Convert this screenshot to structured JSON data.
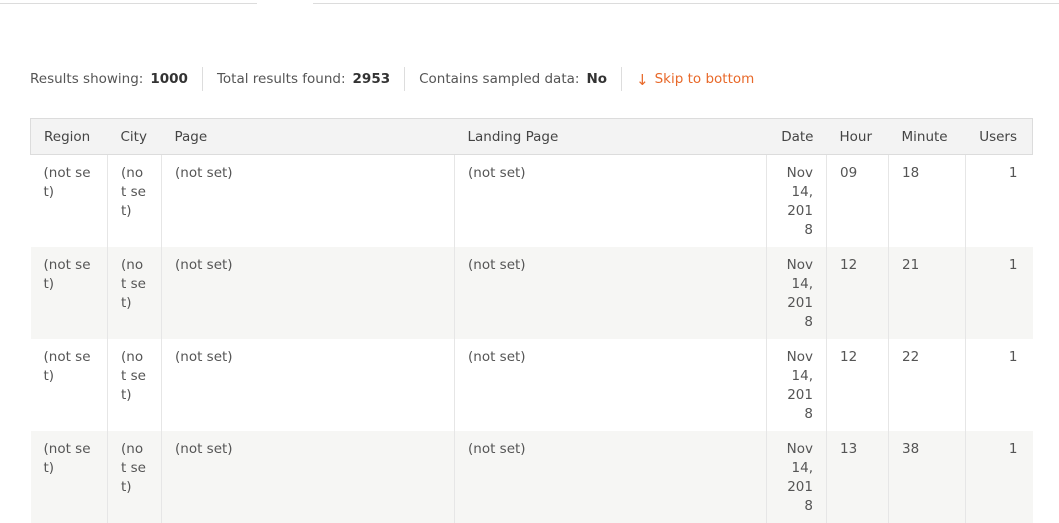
{
  "summary": {
    "results_showing_label": "Results showing:",
    "results_showing_value": "1000",
    "total_results_label": "Total results found:",
    "total_results_value": "2953",
    "sampled_label": "Contains sampled data:",
    "sampled_value": "No",
    "skip_label": "Skip to bottom",
    "skip_arrow": "↓"
  },
  "colors": {
    "accent": "#e8692a",
    "header_bg": "#f3f3f3",
    "alt_row_bg": "#f6f6f4"
  },
  "table": {
    "columns": [
      "Region",
      "City",
      "Page",
      "Landing Page",
      "Date",
      "Hour",
      "Minute",
      "Users"
    ],
    "rows": [
      {
        "region": "(not set)",
        "city": "(not set)",
        "page": "(not set)",
        "landing": "(not set)",
        "date": "Nov 14, 2018",
        "hour": "09",
        "minute": "18",
        "users": "1"
      },
      {
        "region": "(not set)",
        "city": "(not set)",
        "page": "(not set)",
        "landing": "(not set)",
        "date": "Nov 14, 2018",
        "hour": "12",
        "minute": "21",
        "users": "1"
      },
      {
        "region": "(not set)",
        "city": "(not set)",
        "page": "(not set)",
        "landing": "(not set)",
        "date": "Nov 14, 2018",
        "hour": "12",
        "minute": "22",
        "users": "1"
      },
      {
        "region": "(not set)",
        "city": "(not set)",
        "page": "(not set)",
        "landing": "(not set)",
        "date": "Nov 14, 2018",
        "hour": "13",
        "minute": "38",
        "users": "1"
      }
    ]
  }
}
